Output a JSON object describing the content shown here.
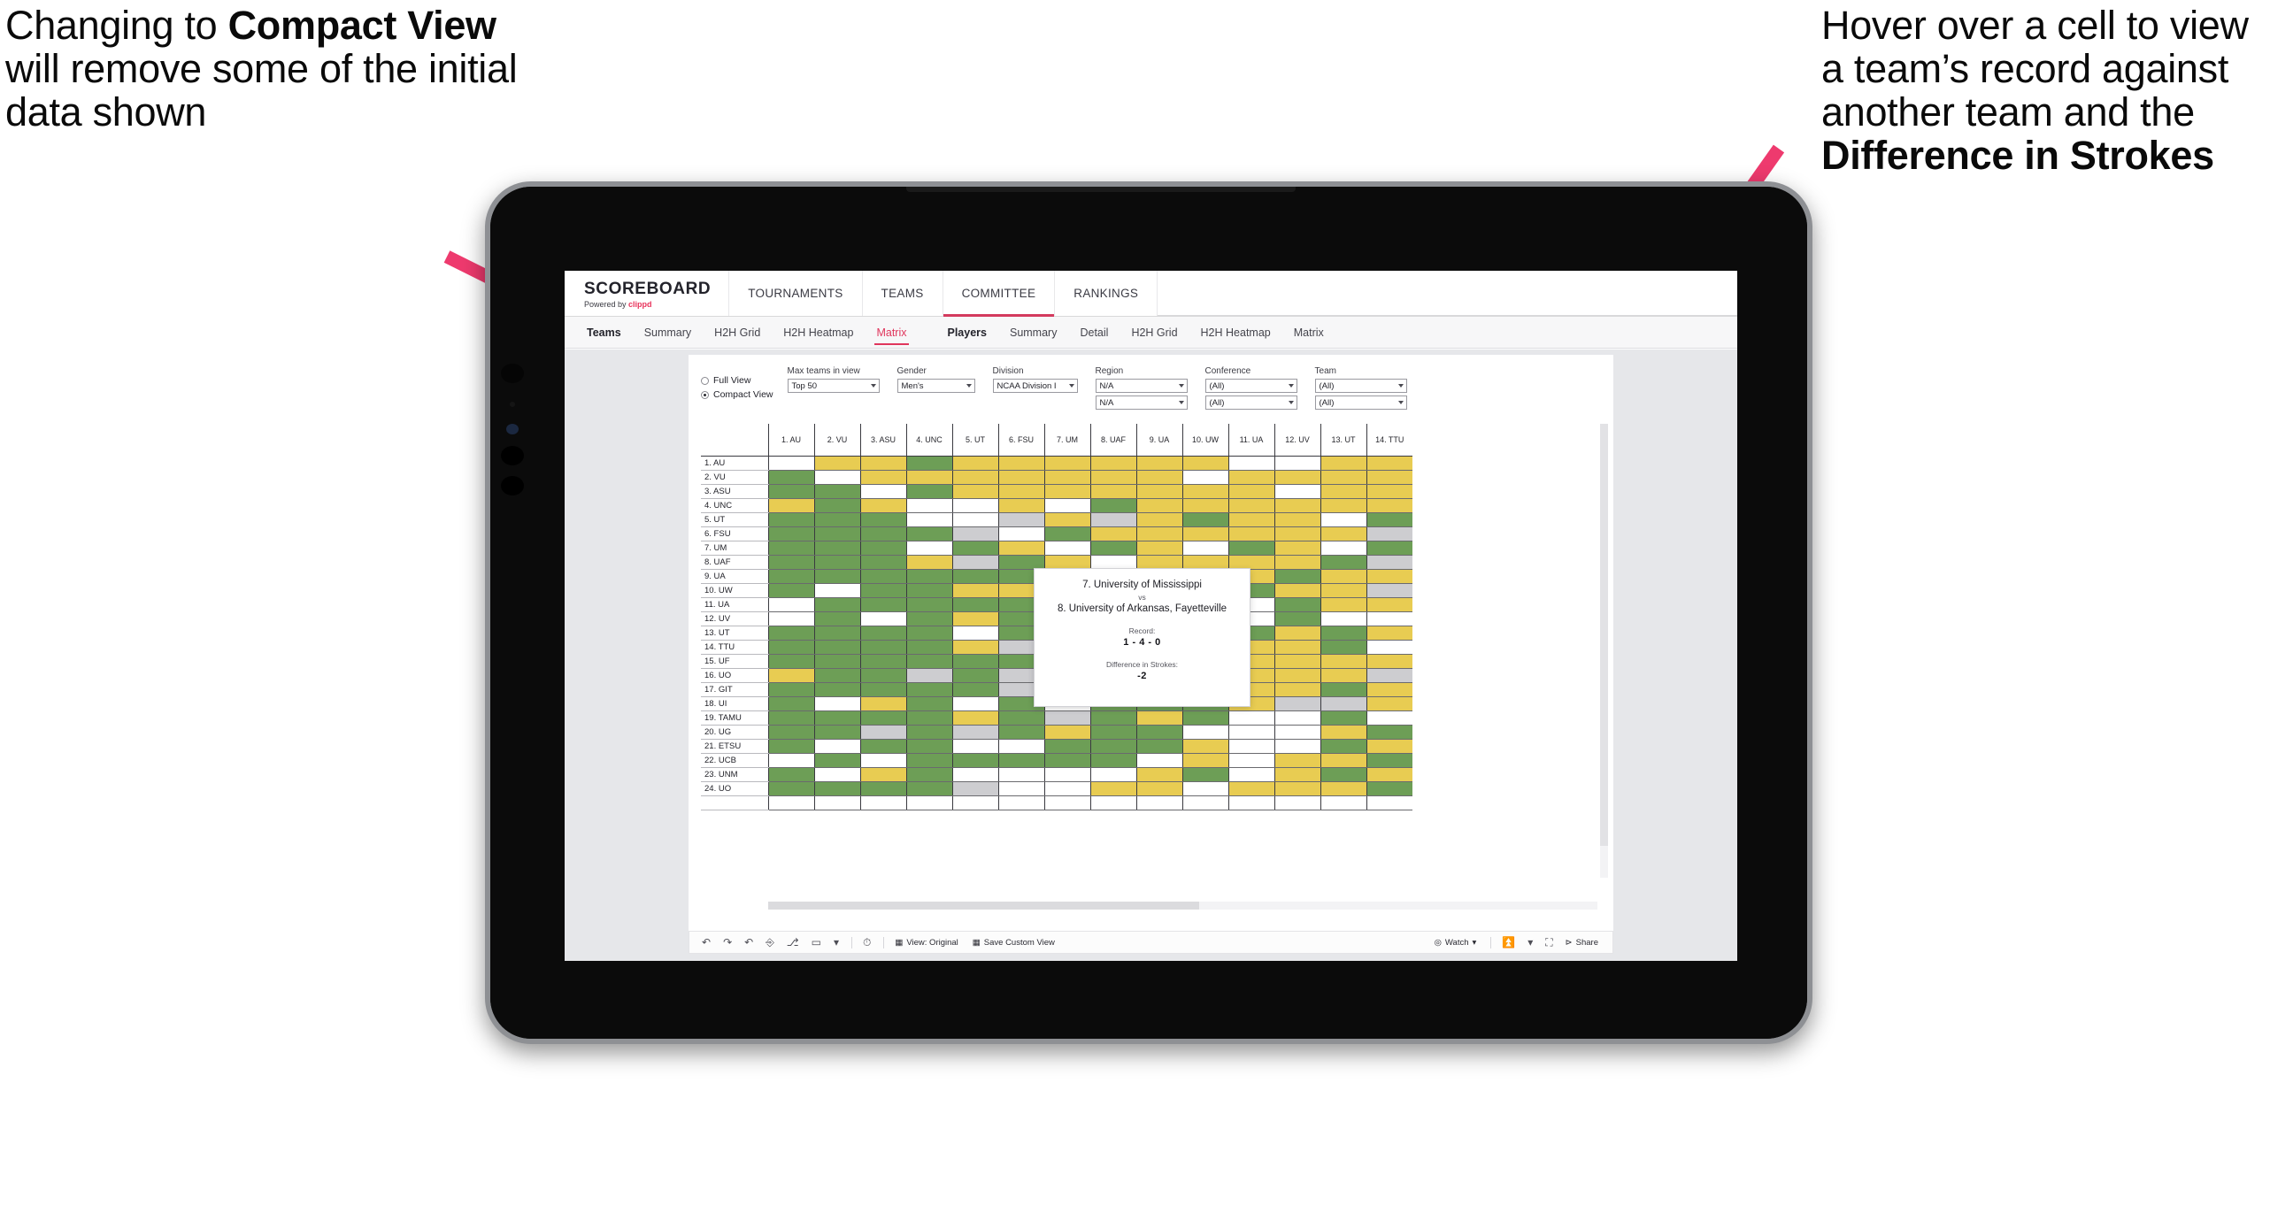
{
  "annotations": {
    "left": {
      "pre": "Changing to ",
      "bold": "Compact View",
      "post": " will remove some of the initial data shown"
    },
    "right": {
      "pre": "Hover over a cell to view a team’s record against another team and the ",
      "bold": "Difference in Strokes",
      "post": ""
    },
    "arrow_color": "#ee3a6e"
  },
  "app": {
    "brand": {
      "title": "SCOREBOARD",
      "powered_prefix": "Powered by ",
      "powered_name": "clippd"
    },
    "topnav": [
      {
        "label": "TOURNAMENTS",
        "active": false
      },
      {
        "label": "TEAMS",
        "active": false
      },
      {
        "label": "COMMITTEE",
        "active": true
      },
      {
        "label": "RANKINGS",
        "active": false
      }
    ],
    "subnav_group_a": [
      "Teams",
      "Summary",
      "H2H Grid",
      "H2H Heatmap",
      "Matrix"
    ],
    "subnav_group_b": [
      "Players",
      "Summary",
      "Detail",
      "H2H Grid",
      "H2H Heatmap",
      "Matrix"
    ],
    "subnav_selected_a": "Matrix",
    "subnav_bold_a": "Teams",
    "subnav_bold_b": "Players",
    "accent": "#e0365c"
  },
  "controls": {
    "view_mode": {
      "options": [
        "Full View",
        "Compact View"
      ],
      "selected": "Compact View"
    },
    "max_teams": {
      "label": "Max teams in view",
      "value": "Top 50"
    },
    "gender": {
      "label": "Gender",
      "value": "Men's"
    },
    "division": {
      "label": "Division",
      "value": "NCAA Division I"
    },
    "region": {
      "label": "Region",
      "value1": "N/A",
      "value2": "N/A"
    },
    "conference": {
      "label": "Conference",
      "value1": "(All)",
      "value2": "(All)"
    },
    "team": {
      "label": "Team",
      "value1": "(All)",
      "value2": "(All)"
    }
  },
  "chart_data": {
    "type": "heatmap",
    "title": "Team Head-to-Head Matrix",
    "legend_colors": {
      "win": "#6d9e56",
      "loss": "#e8cc52",
      "tie": "#cdcdd0",
      "none": "#ffffff"
    },
    "columns": [
      "1. AU",
      "2. VU",
      "3. ASU",
      "4. UNC",
      "5. UT",
      "6. FSU",
      "7. UM",
      "8. UAF",
      "9. UA",
      "10. UW",
      "11. UA",
      "12. UV",
      "13. UT",
      "14. TTU"
    ],
    "rows": [
      "1. AU",
      "2. VU",
      "3. ASU",
      "4. UNC",
      "5. UT",
      "6. FSU",
      "7. UM",
      "8. UAF",
      "9. UA",
      "10. UW",
      "11. UA",
      "12. UV",
      "13. UT",
      "14. TTU",
      "15. UF",
      "16. UO",
      "17. GIT",
      "18. UI",
      "19. TAMU",
      "20. UG",
      "21. ETSU",
      "22. UCB",
      "23. UNM",
      "24. UO"
    ],
    "cells": [
      [
        "w",
        "y",
        "y",
        "g",
        "y",
        "y",
        "y",
        "y",
        "y",
        "y",
        "w",
        "w",
        "y",
        "y"
      ],
      [
        "g",
        "w",
        "y",
        "y",
        "y",
        "y",
        "y",
        "y",
        "y",
        "w",
        "y",
        "y",
        "y",
        "y"
      ],
      [
        "g",
        "g",
        "w",
        "g",
        "y",
        "y",
        "y",
        "y",
        "y",
        "y",
        "y",
        "w",
        "y",
        "y"
      ],
      [
        "y",
        "g",
        "y",
        "w",
        "w",
        "y",
        "w",
        "g",
        "y",
        "y",
        "y",
        "y",
        "y",
        "y"
      ],
      [
        "g",
        "g",
        "g",
        "w",
        "w",
        "s",
        "y",
        "s",
        "y",
        "g",
        "y",
        "y",
        "w",
        "g"
      ],
      [
        "g",
        "g",
        "g",
        "g",
        "s",
        "w",
        "g",
        "y",
        "y",
        "y",
        "y",
        "y",
        "y",
        "s"
      ],
      [
        "g",
        "g",
        "g",
        "w",
        "g",
        "y",
        "w",
        "g",
        "y",
        "w",
        "g",
        "y",
        "w",
        "g"
      ],
      [
        "g",
        "g",
        "g",
        "y",
        "s",
        "g",
        "y",
        "w",
        "y",
        "y",
        "y",
        "y",
        "g",
        "s"
      ],
      [
        "g",
        "g",
        "g",
        "g",
        "g",
        "g",
        "g",
        "g",
        "w",
        "g",
        "y",
        "g",
        "y",
        "y"
      ],
      [
        "g",
        "w",
        "g",
        "g",
        "y",
        "y",
        "w",
        "g",
        "g",
        "w",
        "g",
        "y",
        "y",
        "s"
      ],
      [
        "w",
        "g",
        "g",
        "g",
        "g",
        "g",
        "g",
        "y",
        "w",
        "y",
        "w",
        "g",
        "y",
        "y"
      ],
      [
        "w",
        "g",
        "w",
        "g",
        "y",
        "g",
        "y",
        "y",
        "w",
        "y",
        "w",
        "g",
        "w",
        "w"
      ],
      [
        "g",
        "g",
        "g",
        "g",
        "w",
        "g",
        "w",
        "y",
        "g",
        "w",
        "g",
        "y",
        "g",
        "y"
      ],
      [
        "g",
        "g",
        "g",
        "g",
        "y",
        "s",
        "y",
        "g",
        "g",
        "g",
        "y",
        "y",
        "g",
        "w"
      ],
      [
        "g",
        "g",
        "g",
        "g",
        "g",
        "g",
        "s",
        "g",
        "g",
        "g",
        "y",
        "y",
        "y",
        "y"
      ],
      [
        "y",
        "g",
        "g",
        "s",
        "g",
        "s",
        "y",
        "g",
        "g",
        "y",
        "y",
        "y",
        "y",
        "s"
      ],
      [
        "g",
        "g",
        "g",
        "g",
        "g",
        "s",
        "g",
        "g",
        "g",
        "g",
        "y",
        "y",
        "g",
        "y"
      ],
      [
        "g",
        "w",
        "y",
        "g",
        "w",
        "g",
        "w",
        "g",
        "g",
        "g",
        "y",
        "s",
        "s",
        "y"
      ],
      [
        "g",
        "g",
        "g",
        "g",
        "y",
        "g",
        "s",
        "g",
        "y",
        "g",
        "w",
        "w",
        "g",
        "w"
      ],
      [
        "g",
        "g",
        "s",
        "g",
        "s",
        "g",
        "y",
        "g",
        "g",
        "w",
        "w",
        "w",
        "y",
        "g"
      ],
      [
        "g",
        "w",
        "g",
        "g",
        "w",
        "w",
        "g",
        "g",
        "g",
        "y",
        "w",
        "w",
        "g",
        "y"
      ],
      [
        "w",
        "g",
        "w",
        "g",
        "g",
        "g",
        "g",
        "g",
        "w",
        "y",
        "w",
        "y",
        "y",
        "g"
      ],
      [
        "g",
        "w",
        "y",
        "g",
        "w",
        "w",
        "w",
        "w",
        "y",
        "g",
        "w",
        "y",
        "g",
        "y"
      ],
      [
        "g",
        "g",
        "g",
        "g",
        "s",
        "w",
        "w",
        "y",
        "y",
        "w",
        "y",
        "y",
        "y",
        "g"
      ]
    ]
  },
  "tooltip": {
    "team_a": "7. University of Mississippi",
    "vs": "vs",
    "team_b": "8. University of Arkansas, Fayetteville",
    "record_label": "Record:",
    "record_value": "1 - 4 - 0",
    "diff_label": "Difference in Strokes:",
    "diff_value": "-2"
  },
  "toolbar": {
    "icons": [
      "undo-icon",
      "redo-icon",
      "revert-icon",
      "refresh-data-icon",
      "pause-icon",
      "rect-select-icon",
      "dropdown-caret-icon",
      "clock-icon"
    ],
    "view_original": "View: Original",
    "save_custom_view": "Save Custom View",
    "watch": "Watch",
    "share": "Share"
  }
}
